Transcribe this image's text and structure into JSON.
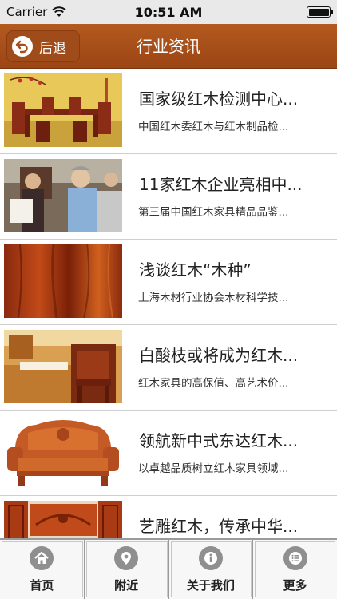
{
  "status_bar": {
    "carrier": "Carrier",
    "time": "10:51 AM",
    "battery_level": 1.0
  },
  "nav": {
    "back_label": "后退",
    "title": "行业资讯"
  },
  "news": [
    {
      "title": "国家级红木检测中心...",
      "subtitle": "中国红木委红木与红木制品检...",
      "thumb": "dining-table"
    },
    {
      "title": "11家红木企业亮相中...",
      "subtitle": "第三届中国红木家具精品品鉴...",
      "thumb": "people-exhibit"
    },
    {
      "title": "浅谈红木“木种”",
      "subtitle": "上海木材行业协会木材科学技...",
      "thumb": "wood-grain"
    },
    {
      "title": "白酸枝或将成为红木...",
      "subtitle": "红木家具的高保值、高艺术价...",
      "thumb": "chair-interior"
    },
    {
      "title": "领航新中式东达红木...",
      "subtitle": "以卓越品质树立红木家具领域...",
      "thumb": "carved-sofa"
    },
    {
      "title": "艺雕红木，传承中华...",
      "subtitle": "",
      "thumb": "carved-cabinet"
    }
  ],
  "tabs": [
    {
      "label": "首页",
      "icon": "home-icon"
    },
    {
      "label": "附近",
      "icon": "location-pin-icon"
    },
    {
      "label": "关于我们",
      "icon": "info-icon"
    },
    {
      "label": "更多",
      "icon": "list-icon"
    }
  ],
  "colors": {
    "nav_bar": "#a54e19",
    "tab_icon": "#8f8f8f"
  }
}
